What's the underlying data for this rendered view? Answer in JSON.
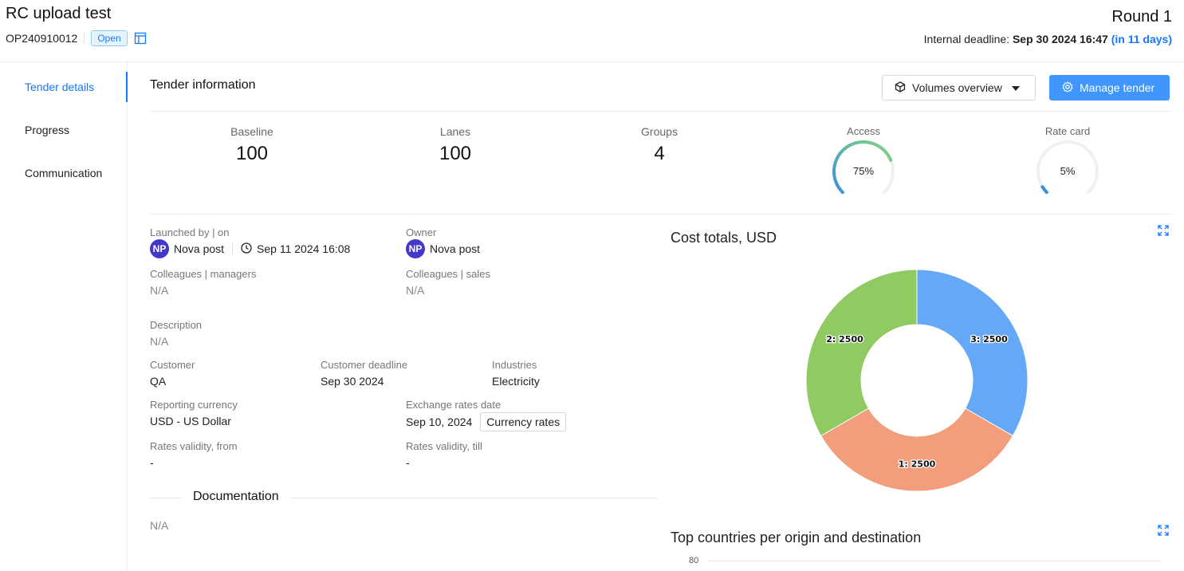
{
  "header": {
    "title": "RC upload test",
    "code": "OP240910012",
    "status": "Open",
    "round": "Round 1",
    "deadline_label": "Internal deadline:",
    "deadline_value": "Sep 30 2024 16:47",
    "deadline_days": "(in 11 days)"
  },
  "sidebar": {
    "items": [
      {
        "label": "Tender details"
      },
      {
        "label": "Progress"
      },
      {
        "label": "Communication"
      }
    ]
  },
  "main": {
    "section_title": "Tender information",
    "volumes_button": "Volumes overview",
    "manage_button": "Manage tender"
  },
  "stats": {
    "baseline_label": "Baseline",
    "baseline_value": "100",
    "lanes_label": "Lanes",
    "lanes_value": "100",
    "groups_label": "Groups",
    "groups_value": "4",
    "access_label": "Access",
    "access_value": "75%",
    "access_fraction": 0.75,
    "ratecard_label": "Rate card",
    "ratecard_value": "5%",
    "ratecard_fraction": 0.05
  },
  "details": {
    "launched_label": "Launched by | on",
    "launched_avatar": "NP",
    "launched_by": "Nova post",
    "launched_on": "Sep 11 2024 16:08",
    "owner_label": "Owner",
    "owner_avatar": "NP",
    "owner": "Nova post",
    "colleagues_managers_label": "Colleagues | managers",
    "colleagues_managers": "N/A",
    "colleagues_sales_label": "Colleagues | sales",
    "colleagues_sales": "N/A",
    "description_label": "Description",
    "description": "N/A",
    "customer_label": "Customer",
    "customer": "QA",
    "customer_deadline_label": "Customer deadline",
    "customer_deadline": "Sep 30 2024",
    "industries_label": "Industries",
    "industries": "Electricity",
    "reporting_currency_label": "Reporting currency",
    "reporting_currency": "USD - US Dollar",
    "exchange_date_label": "Exchange rates date",
    "exchange_date": "Sep 10, 2024",
    "currency_rates_button": "Currency rates",
    "validity_from_label": "Rates validity, from",
    "validity_from": "-",
    "validity_till_label": "Rates validity, till",
    "validity_till": "-",
    "documentation_title": "Documentation",
    "documentation": "N/A"
  },
  "colors": {
    "accent": "#1677ff",
    "slice1": "#f29e7d",
    "slice2": "#8fcb62",
    "slice3": "#64a8f7"
  },
  "chart_data": [
    {
      "type": "pie",
      "title": "Cost totals, USD",
      "categories": [
        "1",
        "2",
        "3"
      ],
      "values": [
        2500,
        2500,
        2500
      ],
      "data_labels": [
        "1: 2500",
        "2: 2500",
        "3: 2500"
      ]
    },
    {
      "type": "bar",
      "title": "Top countries per origin and destination",
      "y_tick_labels": [
        "80"
      ]
    }
  ]
}
